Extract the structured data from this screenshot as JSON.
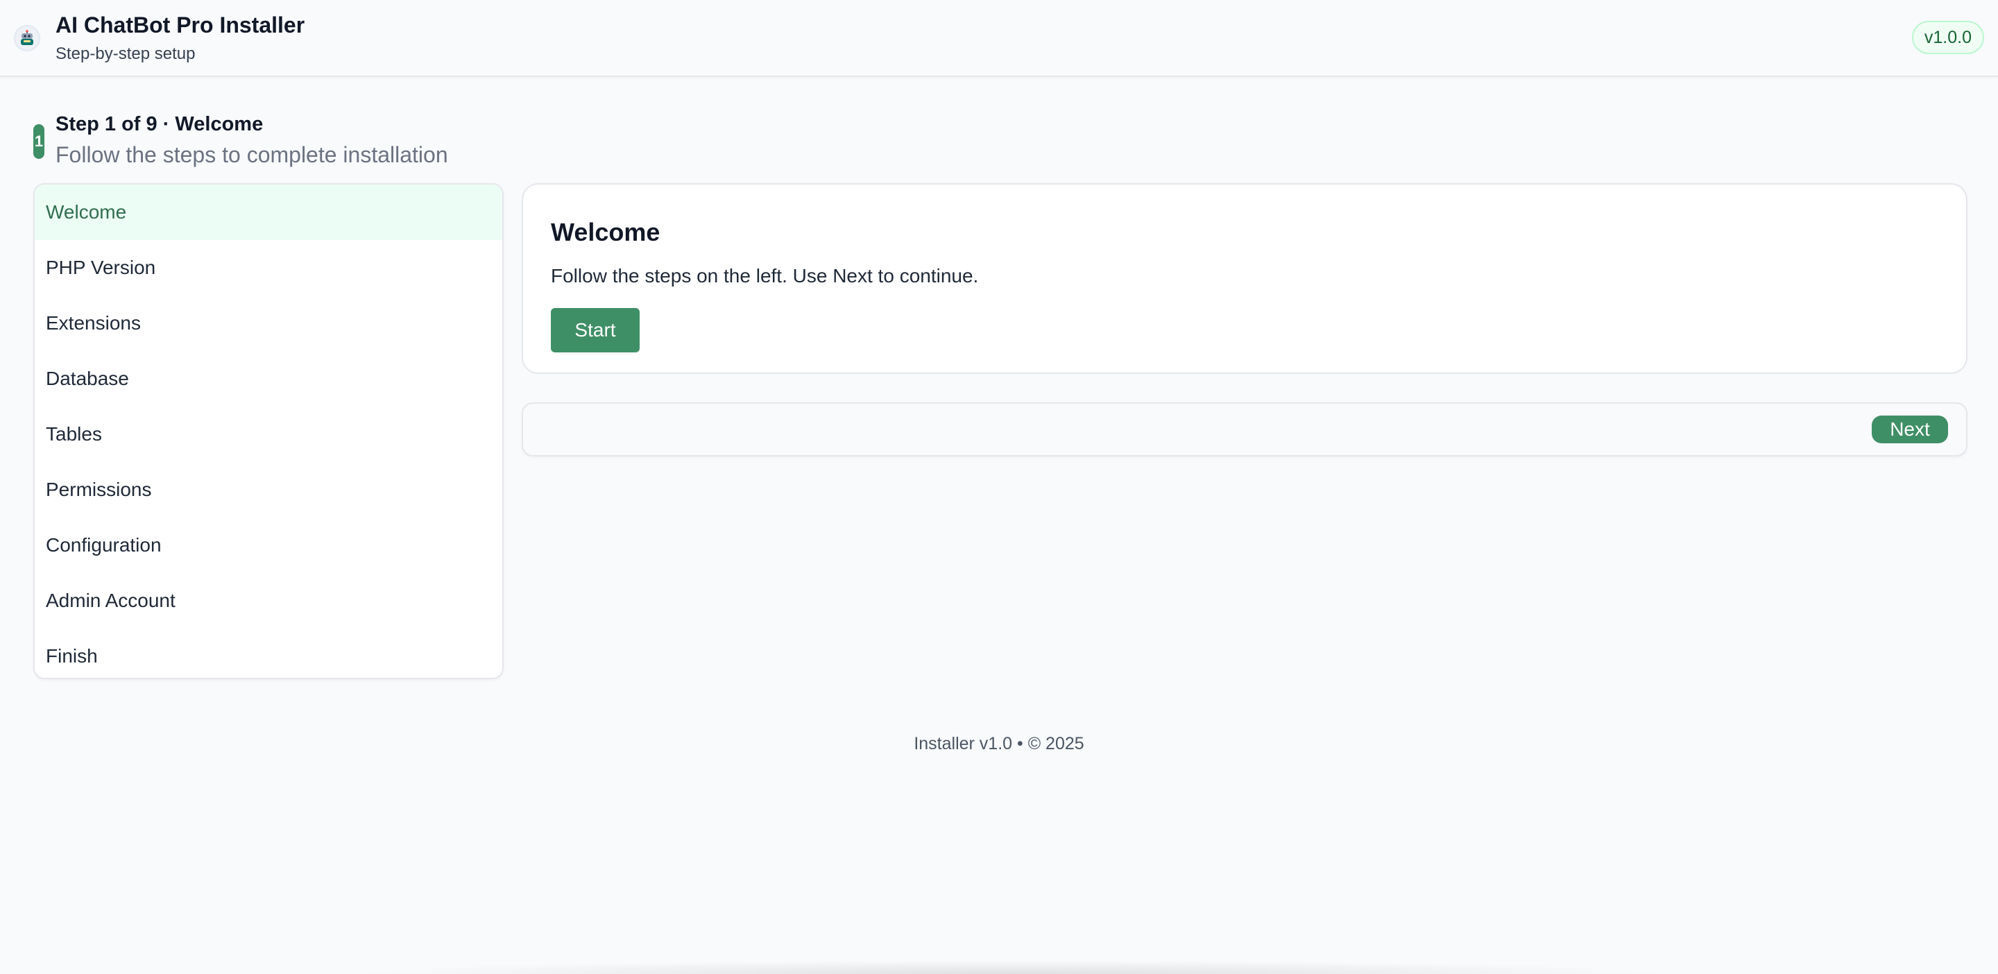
{
  "header": {
    "title": "AI ChatBot Pro Installer",
    "subtitle": "Step-by-step setup",
    "version": "v1.0.0",
    "logo_icon": "robot-icon"
  },
  "step": {
    "number": "1",
    "heading": "Step 1 of 9 · Welcome",
    "description": "Follow the steps to complete installation"
  },
  "sidebar": {
    "active_index": 0,
    "items": [
      {
        "label": "Welcome"
      },
      {
        "label": "PHP Version"
      },
      {
        "label": "Extensions"
      },
      {
        "label": "Database"
      },
      {
        "label": "Tables"
      },
      {
        "label": "Permissions"
      },
      {
        "label": "Configuration"
      },
      {
        "label": "Admin Account"
      },
      {
        "label": "Finish"
      }
    ]
  },
  "content": {
    "title": "Welcome",
    "text": "Follow the steps on the left. Use Next to continue.",
    "start_label": "Start"
  },
  "nav": {
    "next_label": "Next"
  },
  "footer": {
    "text": "Installer v1.0 • © 2025"
  },
  "colors": {
    "accent": "#3f8f66",
    "active_item_bg": "#ecfdf5",
    "badge_border": "#bbf7d0"
  }
}
